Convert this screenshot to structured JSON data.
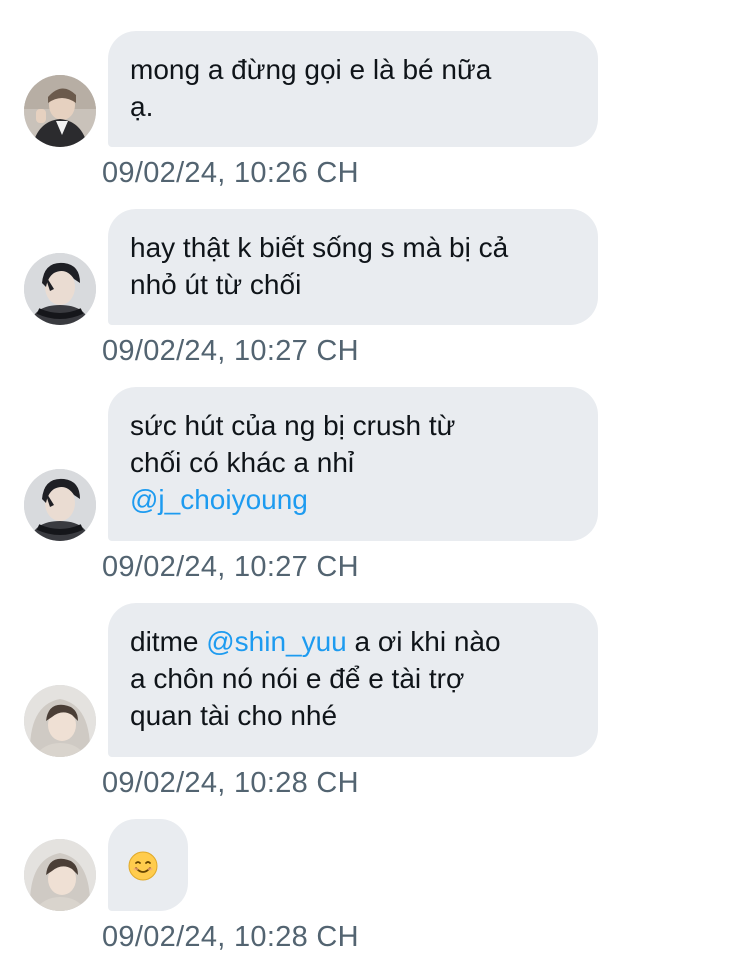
{
  "messages": [
    {
      "avatar": "user-avatar-suit",
      "text": "mong a đừng gọi e là bé nữa ạ.",
      "line1": "mong a đừng gọi e là bé nữa",
      "line2": "ạ.",
      "timestamp": "09/02/24, 10:26 CH"
    },
    {
      "avatar": "user-avatar-headphones",
      "line1": "hay thật k biết sống s mà bị cả",
      "line2": "nhỏ út từ chối",
      "timestamp": "09/02/24, 10:27 CH"
    },
    {
      "avatar": "user-avatar-headphones",
      "line1": "sức hút của ng bị crush từ",
      "line2": "chối có khác a nhỉ",
      "mention": "@j_choiyoung",
      "timestamp": "09/02/24, 10:27 CH"
    },
    {
      "avatar": "user-avatar-hood",
      "prefix": "ditme ",
      "mention": "@shin_yuu",
      "suffix": " a ơi khi nào",
      "line2": "a chôn nó nói e để e tài trợ",
      "line3": "quan tài cho nhé",
      "timestamp": "09/02/24, 10:28 CH"
    },
    {
      "avatar": "user-avatar-hood",
      "emoji": "smiling-face-emoji",
      "timestamp": "09/02/24, 10:28 CH"
    }
  ],
  "colors": {
    "bubble": "#e9ecf0",
    "text": "#0f1419",
    "mention": "#1d9bf0",
    "timestamp": "#536471"
  }
}
